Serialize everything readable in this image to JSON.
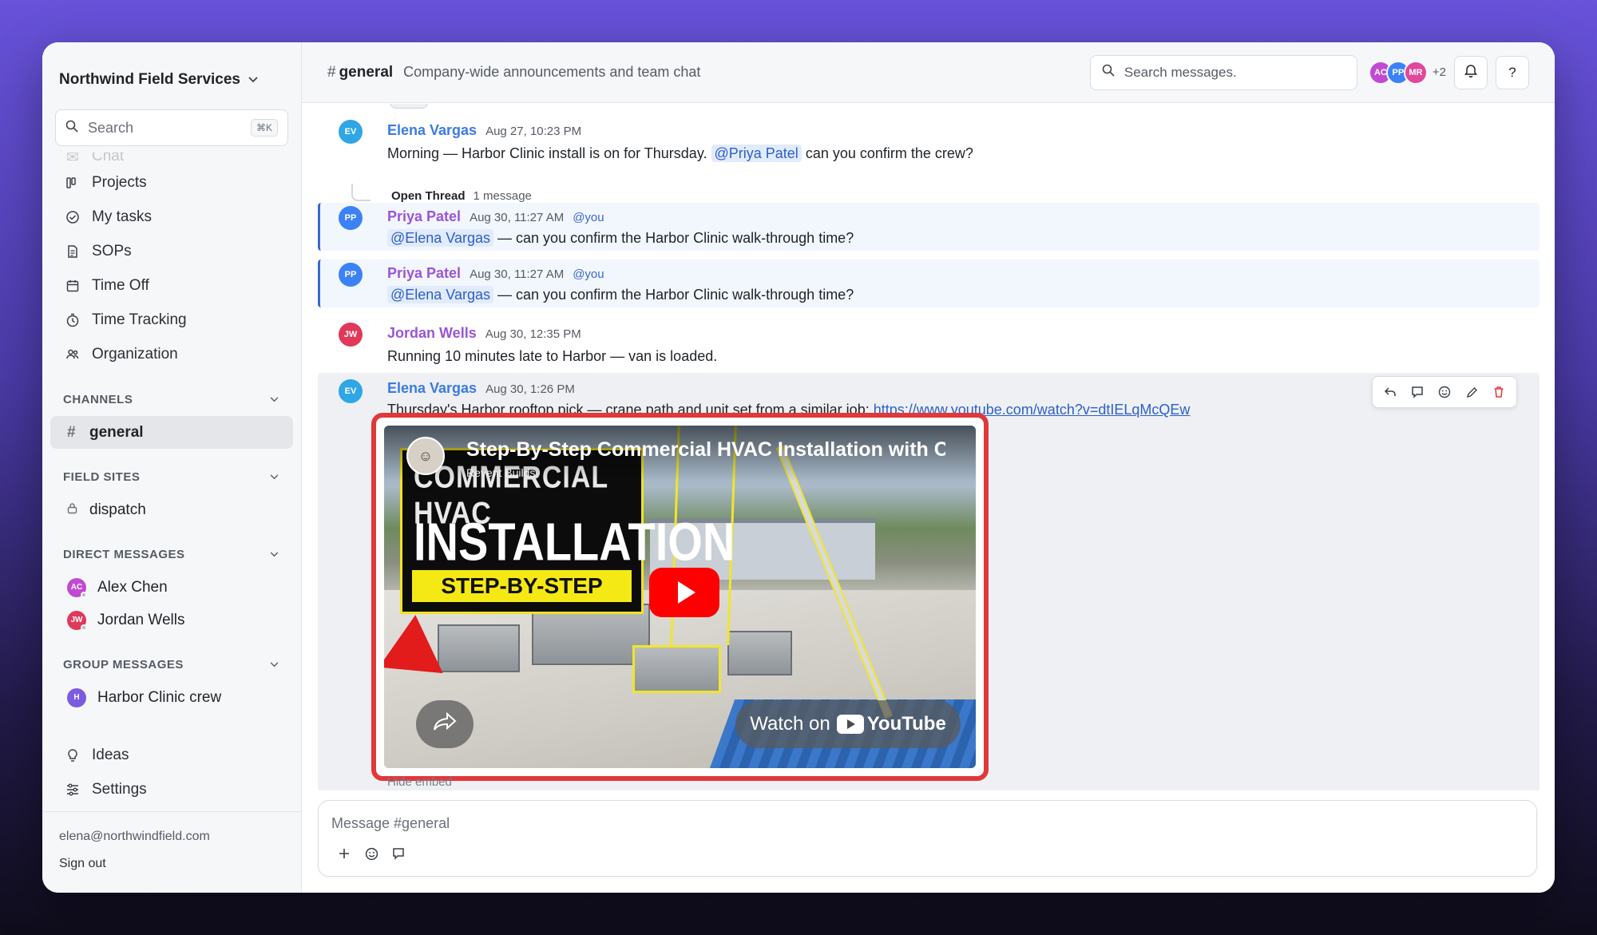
{
  "workspace": {
    "name": "Northwind Field Services"
  },
  "sidebar": {
    "search_placeholder": "Search",
    "search_shortcut": "⌘K",
    "faded_item": "Chat",
    "nav": [
      {
        "label": "Projects",
        "icon": "kanban-icon"
      },
      {
        "label": "My tasks",
        "icon": "check-circle-icon"
      },
      {
        "label": "SOPs",
        "icon": "document-icon"
      },
      {
        "label": "Time Off",
        "icon": "calendar-icon"
      },
      {
        "label": "Time Tracking",
        "icon": "clock-icon"
      },
      {
        "label": "Organization",
        "icon": "people-icon"
      }
    ],
    "sections": {
      "channels": "CHANNELS",
      "field_sites": "FIELD SITES",
      "direct_messages": "DIRECT MESSAGES",
      "group_messages": "GROUP MESSAGES"
    },
    "channels": [
      {
        "name": "general",
        "active": true
      }
    ],
    "field_sites": [
      {
        "name": "dispatch"
      }
    ],
    "direct_messages": [
      {
        "initials": "AC",
        "name": "Alex Chen",
        "color": "#c04ad3"
      },
      {
        "initials": "JW",
        "name": "Jordan Wells",
        "color": "#e0395a"
      }
    ],
    "group_messages": [
      {
        "initials": "H",
        "name": "Harbor Clinic crew",
        "color": "#7b5be0"
      }
    ],
    "bottom_nav": [
      {
        "label": "Ideas",
        "icon": "lightbulb-icon"
      },
      {
        "label": "Settings",
        "icon": "sliders-icon"
      }
    ],
    "footer": {
      "email": "elena@northwindfield.com",
      "signout": "Sign out"
    }
  },
  "header": {
    "channel_hash": "#",
    "channel_name": "general",
    "description": "Company-wide announcements and team chat",
    "search_placeholder": "Search messages.",
    "avatars": [
      {
        "initials": "AC",
        "color": "#c04ad3"
      },
      {
        "initials": "PP",
        "color": "#3b82f6"
      },
      {
        "initials": "MR",
        "color": "#e0489c"
      }
    ],
    "more_count": "+2",
    "help_label": "?"
  },
  "messages": [
    {
      "initials": "EV",
      "author": "Elena Vargas",
      "color": "#2fa6e6",
      "author_color": "#3b7be0",
      "time": "Aug 27, 10:23 PM",
      "text_before": "Morning — Harbor Clinic install is on for Thursday.",
      "mention": "@Priya Patel",
      "text_after": "can you confirm the crew?",
      "thread_label": "Open Thread",
      "thread_count": "1 message"
    },
    {
      "initials": "PP",
      "author": "Priya Patel",
      "color": "#3b82f6",
      "author_color": "#9b55d6",
      "time": "Aug 30, 11:27 AM",
      "you_tag": "@you",
      "mention": "@Elena Vargas",
      "text_after": "— can you confirm the Harbor Clinic walk-through time?"
    },
    {
      "initials": "PP",
      "author": "Priya Patel",
      "color": "#3b82f6",
      "author_color": "#9b55d6",
      "time": "Aug 30, 11:27 AM",
      "you_tag": "@you",
      "mention": "@Elena Vargas",
      "text_after": "— can you confirm the Harbor Clinic walk-through time?"
    },
    {
      "initials": "JW",
      "author": "Jordan Wells",
      "color": "#e0395a",
      "author_color": "#9b55d6",
      "time": "Aug 30, 12:35 PM",
      "text": "Running 10 minutes late to Harbor — van is loaded."
    },
    {
      "initials": "EV",
      "author": "Elena Vargas",
      "color": "#2fa6e6",
      "author_color": "#3b7be0",
      "time": "Aug 30, 1:26 PM",
      "text_before": "Thursday's Harbor rooftop pick — crane path and unit set from a similar job:",
      "link": "https://www.youtube.com/watch?v=dtIELqMcQEw",
      "embed": {
        "title": "Step-By-Step Commercial HVAC Installation with Cr",
        "channel": "Revent Builds",
        "thumb_line1": "COMMERCIAL HVAC",
        "thumb_line2": "INSTALLATION",
        "thumb_line3": "STEP-BY-STEP",
        "watch_on": "Watch on",
        "youtube": "YouTube"
      },
      "hide_embed": "Hide embed"
    }
  ],
  "composer": {
    "placeholder": "Message #general"
  }
}
